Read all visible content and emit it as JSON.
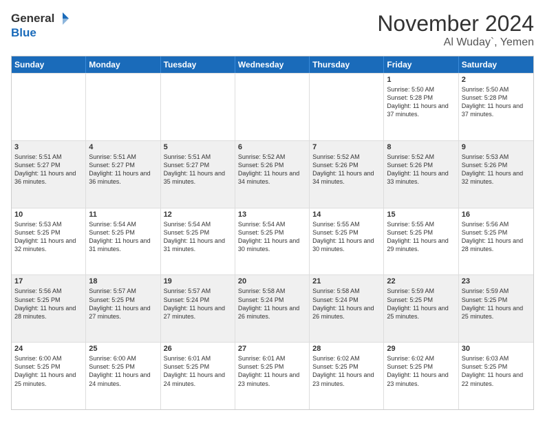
{
  "logo": {
    "line1": "General",
    "line2": "Blue"
  },
  "title": "November 2024",
  "subtitle": "Al Wuday`, Yemen",
  "days": [
    "Sunday",
    "Monday",
    "Tuesday",
    "Wednesday",
    "Thursday",
    "Friday",
    "Saturday"
  ],
  "weeks": [
    [
      {
        "day": "",
        "info": ""
      },
      {
        "day": "",
        "info": ""
      },
      {
        "day": "",
        "info": ""
      },
      {
        "day": "",
        "info": ""
      },
      {
        "day": "",
        "info": ""
      },
      {
        "day": "1",
        "info": "Sunrise: 5:50 AM\nSunset: 5:28 PM\nDaylight: 11 hours and 37 minutes."
      },
      {
        "day": "2",
        "info": "Sunrise: 5:50 AM\nSunset: 5:28 PM\nDaylight: 11 hours and 37 minutes."
      }
    ],
    [
      {
        "day": "3",
        "info": "Sunrise: 5:51 AM\nSunset: 5:27 PM\nDaylight: 11 hours and 36 minutes."
      },
      {
        "day": "4",
        "info": "Sunrise: 5:51 AM\nSunset: 5:27 PM\nDaylight: 11 hours and 36 minutes."
      },
      {
        "day": "5",
        "info": "Sunrise: 5:51 AM\nSunset: 5:27 PM\nDaylight: 11 hours and 35 minutes."
      },
      {
        "day": "6",
        "info": "Sunrise: 5:52 AM\nSunset: 5:26 PM\nDaylight: 11 hours and 34 minutes."
      },
      {
        "day": "7",
        "info": "Sunrise: 5:52 AM\nSunset: 5:26 PM\nDaylight: 11 hours and 34 minutes."
      },
      {
        "day": "8",
        "info": "Sunrise: 5:52 AM\nSunset: 5:26 PM\nDaylight: 11 hours and 33 minutes."
      },
      {
        "day": "9",
        "info": "Sunrise: 5:53 AM\nSunset: 5:26 PM\nDaylight: 11 hours and 32 minutes."
      }
    ],
    [
      {
        "day": "10",
        "info": "Sunrise: 5:53 AM\nSunset: 5:25 PM\nDaylight: 11 hours and 32 minutes."
      },
      {
        "day": "11",
        "info": "Sunrise: 5:54 AM\nSunset: 5:25 PM\nDaylight: 11 hours and 31 minutes."
      },
      {
        "day": "12",
        "info": "Sunrise: 5:54 AM\nSunset: 5:25 PM\nDaylight: 11 hours and 31 minutes."
      },
      {
        "day": "13",
        "info": "Sunrise: 5:54 AM\nSunset: 5:25 PM\nDaylight: 11 hours and 30 minutes."
      },
      {
        "day": "14",
        "info": "Sunrise: 5:55 AM\nSunset: 5:25 PM\nDaylight: 11 hours and 30 minutes."
      },
      {
        "day": "15",
        "info": "Sunrise: 5:55 AM\nSunset: 5:25 PM\nDaylight: 11 hours and 29 minutes."
      },
      {
        "day": "16",
        "info": "Sunrise: 5:56 AM\nSunset: 5:25 PM\nDaylight: 11 hours and 28 minutes."
      }
    ],
    [
      {
        "day": "17",
        "info": "Sunrise: 5:56 AM\nSunset: 5:25 PM\nDaylight: 11 hours and 28 minutes."
      },
      {
        "day": "18",
        "info": "Sunrise: 5:57 AM\nSunset: 5:25 PM\nDaylight: 11 hours and 27 minutes."
      },
      {
        "day": "19",
        "info": "Sunrise: 5:57 AM\nSunset: 5:24 PM\nDaylight: 11 hours and 27 minutes."
      },
      {
        "day": "20",
        "info": "Sunrise: 5:58 AM\nSunset: 5:24 PM\nDaylight: 11 hours and 26 minutes."
      },
      {
        "day": "21",
        "info": "Sunrise: 5:58 AM\nSunset: 5:24 PM\nDaylight: 11 hours and 26 minutes."
      },
      {
        "day": "22",
        "info": "Sunrise: 5:59 AM\nSunset: 5:25 PM\nDaylight: 11 hours and 25 minutes."
      },
      {
        "day": "23",
        "info": "Sunrise: 5:59 AM\nSunset: 5:25 PM\nDaylight: 11 hours and 25 minutes."
      }
    ],
    [
      {
        "day": "24",
        "info": "Sunrise: 6:00 AM\nSunset: 5:25 PM\nDaylight: 11 hours and 25 minutes."
      },
      {
        "day": "25",
        "info": "Sunrise: 6:00 AM\nSunset: 5:25 PM\nDaylight: 11 hours and 24 minutes."
      },
      {
        "day": "26",
        "info": "Sunrise: 6:01 AM\nSunset: 5:25 PM\nDaylight: 11 hours and 24 minutes."
      },
      {
        "day": "27",
        "info": "Sunrise: 6:01 AM\nSunset: 5:25 PM\nDaylight: 11 hours and 23 minutes."
      },
      {
        "day": "28",
        "info": "Sunrise: 6:02 AM\nSunset: 5:25 PM\nDaylight: 11 hours and 23 minutes."
      },
      {
        "day": "29",
        "info": "Sunrise: 6:02 AM\nSunset: 5:25 PM\nDaylight: 11 hours and 23 minutes."
      },
      {
        "day": "30",
        "info": "Sunrise: 6:03 AM\nSunset: 5:25 PM\nDaylight: 11 hours and 22 minutes."
      }
    ]
  ]
}
